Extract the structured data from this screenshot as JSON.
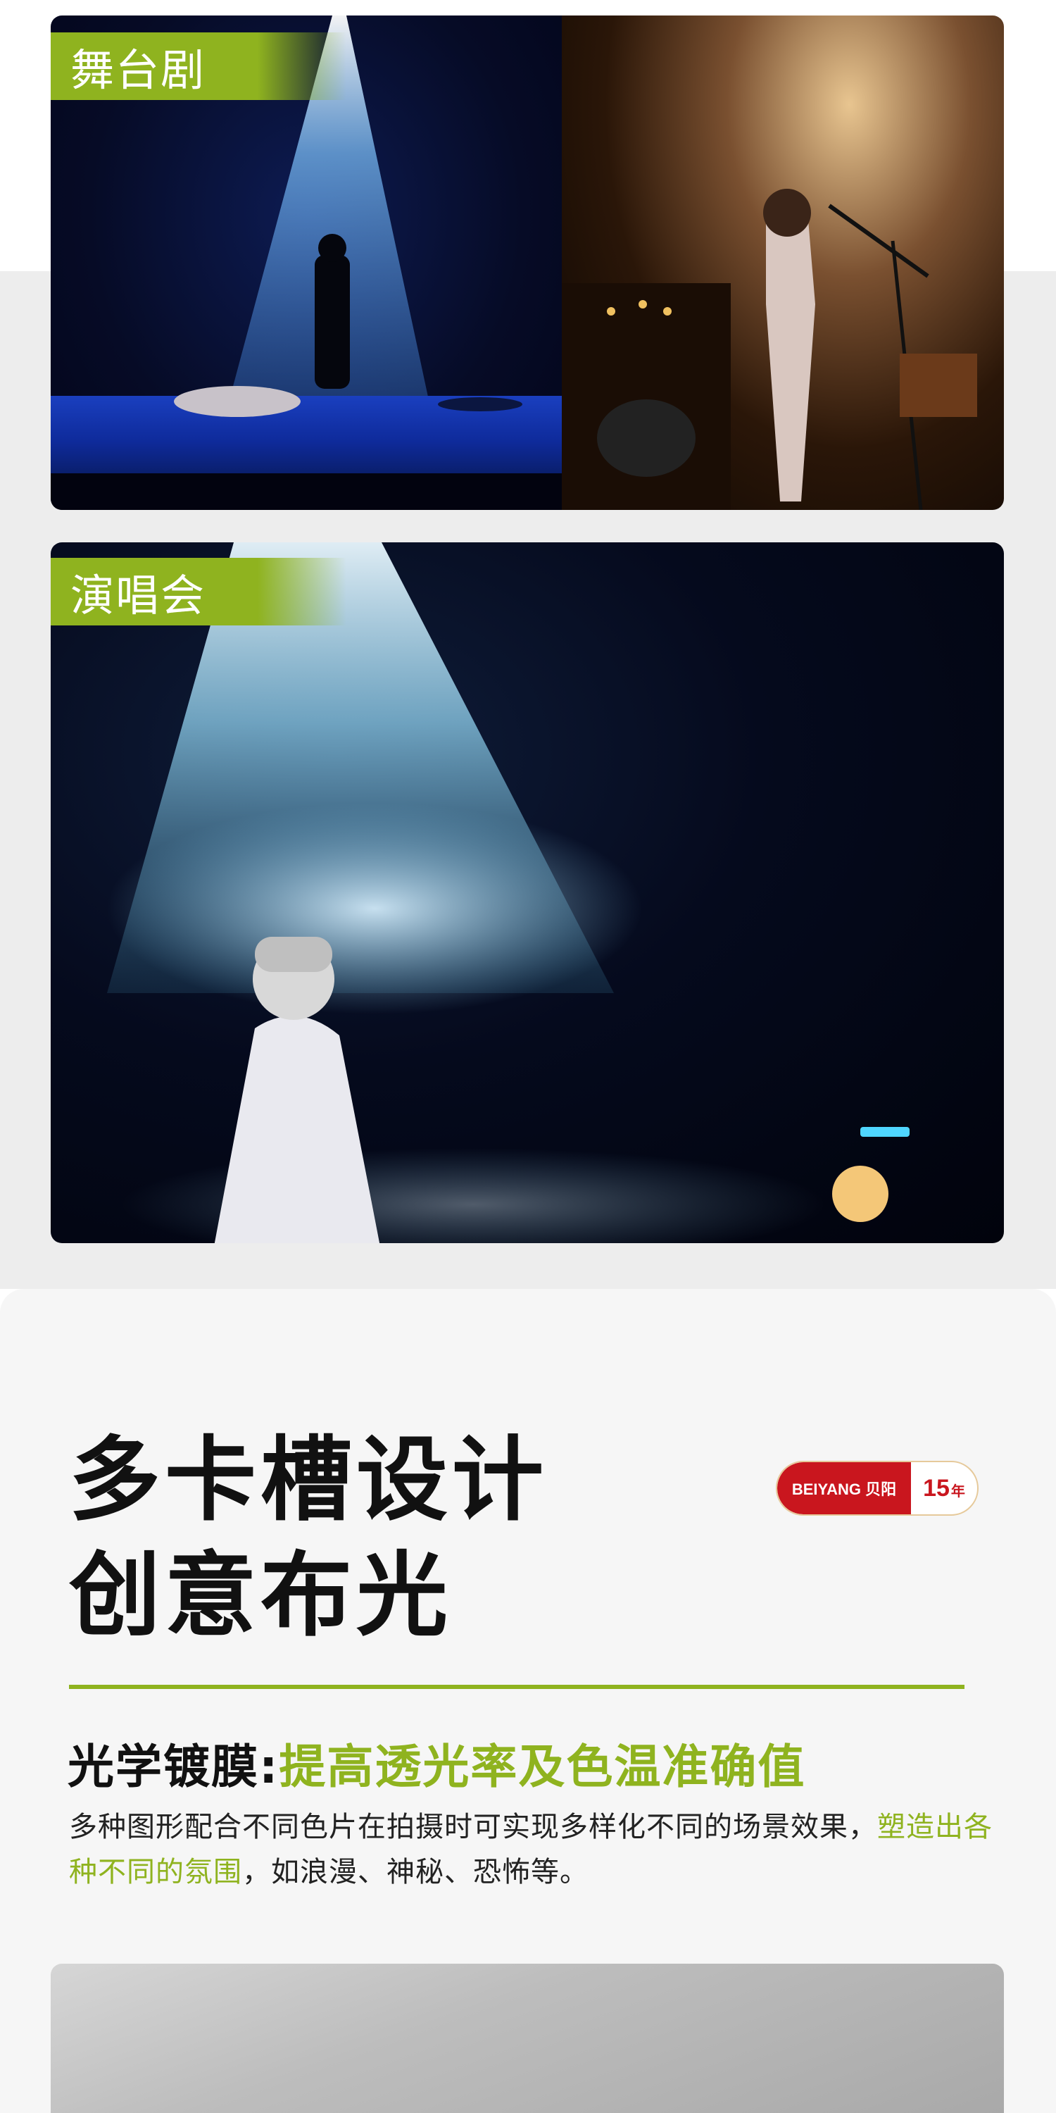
{
  "gallery": {
    "tag_theatre": "舞台剧",
    "tag_concert": "演唱会"
  },
  "feature": {
    "title_line1": "多卡槽设计",
    "title_line2": "创意布光",
    "brand_badge": {
      "brand": "BEIYANG 贝阳",
      "years_number": "15",
      "years_unit": "年"
    },
    "subhead_label": "光学镀膜:",
    "subhead_accent": "提高透光率及色温准确值",
    "desc_part1": "多种图形配合不同色片在拍摄时可实现多样化不同的场景效果，",
    "desc_accent": "塑造出各种不同的氛围",
    "desc_part2": "，如浪漫、神秘、恐怖等。"
  },
  "colors": {
    "accent_green": "#8fb31f",
    "brand_red": "#c9161e",
    "title_black": "#111111"
  }
}
